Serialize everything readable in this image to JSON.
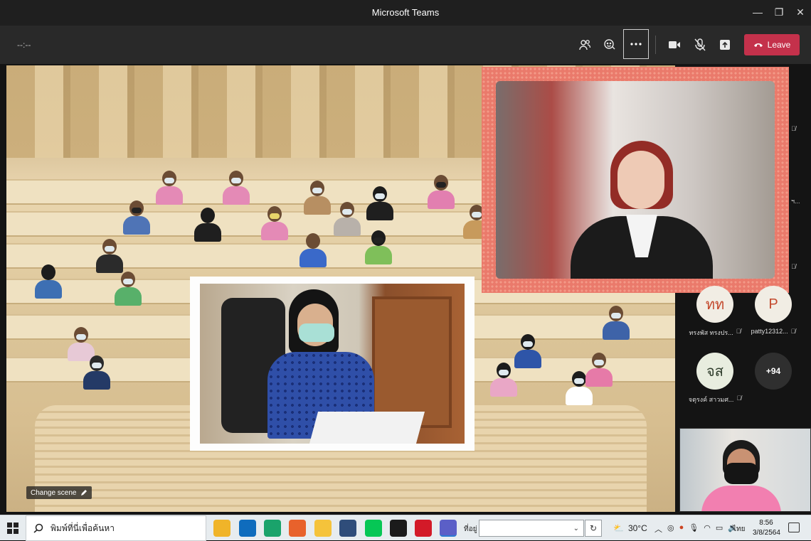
{
  "window": {
    "title": "Microsoft Teams",
    "minimize_glyph": "—",
    "maximize_glyph": "❐",
    "close_glyph": "✕"
  },
  "meeting": {
    "timer": "--:--",
    "leave_label": "Leave",
    "change_scene_label": "Change scene",
    "controls": [
      "people-icon",
      "reactions-icon",
      "more-options-icon",
      "camera-icon",
      "mic-off-icon",
      "share-icon"
    ]
  },
  "roster": {
    "participants": [
      {
        "initials": "ทท",
        "name": "ทรงพัส ทรงปร...",
        "muted": true,
        "style": "light"
      },
      {
        "initials": "P",
        "name": "patty12312...",
        "muted": true,
        "style": "light"
      },
      {
        "initials": "จส",
        "name": "จตุรงค์ สาวมศ...",
        "muted": true,
        "style": "green"
      },
      {
        "initials": "+94",
        "name": "",
        "muted": false,
        "style": "dark"
      }
    ],
    "partial_labels": [
      "ฯ..."
    ]
  },
  "taskbar": {
    "search_placeholder": "พิมพ์ที่นี่เพื่อค้นหา",
    "address_label": "ที่อยู่",
    "weather": "30°C",
    "language": "ไทย",
    "time": "8:56",
    "date": "3/8/2564",
    "apps": [
      {
        "name": "file-explorer-icon",
        "color": "#f0b429"
      },
      {
        "name": "mail-icon",
        "color": "#0f6cbd"
      },
      {
        "name": "edge-icon",
        "color": "#1aa36b"
      },
      {
        "name": "firefox-icon",
        "color": "#e8622c"
      },
      {
        "name": "chrome-icon",
        "color": "#f5c33b"
      },
      {
        "name": "dell-icon",
        "color": "#2f4d7a"
      },
      {
        "name": "line-icon",
        "color": "#06c755"
      },
      {
        "name": "dropbox-icon",
        "color": "#1b1b1b"
      },
      {
        "name": "opera-icon",
        "color": "#d31a28"
      },
      {
        "name": "teams-icon",
        "color": "#5b5fc7"
      }
    ]
  }
}
